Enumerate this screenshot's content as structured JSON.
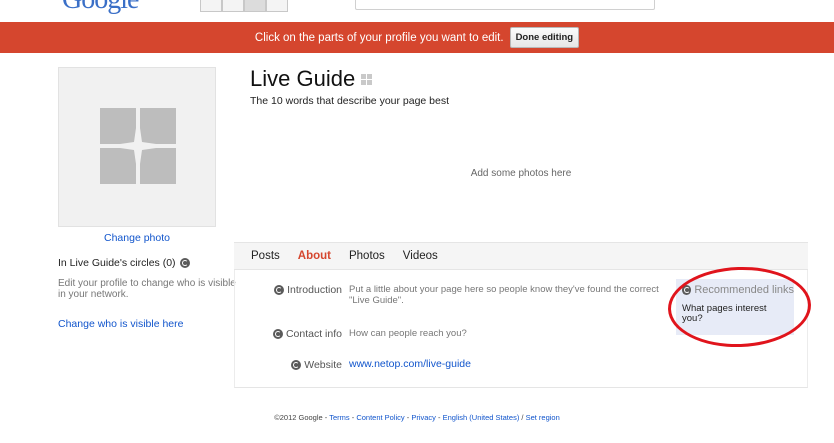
{
  "banner": {
    "message": "Click on the parts of your profile you want to edit.",
    "done_label": "Done editing"
  },
  "sidebar": {
    "change_photo": "Change photo",
    "circles": "In Live Guide's circles (0)",
    "edit_note": "Edit your profile to change who is visible in your network.",
    "change_visible": "Change who is visible here"
  },
  "profile": {
    "name": "Live Guide",
    "tagline": "The 10 words that describe your page best",
    "add_photos": "Add some photos here"
  },
  "tabs": [
    {
      "label": "Posts",
      "active": false
    },
    {
      "label": "About",
      "active": true
    },
    {
      "label": "Photos",
      "active": false
    },
    {
      "label": "Videos",
      "active": false
    }
  ],
  "about": {
    "introduction_label": "Introduction",
    "introduction_value": "Put a little about your page here so people know they've found the correct \"Live Guide\".",
    "contact_label": "Contact info",
    "contact_value": "How can people reach you?",
    "website_label": "Website",
    "website_value": "www.netop.com/live-guide",
    "recommended_title": "Recommended links",
    "recommended_question": "What pages interest you?"
  },
  "footer": {
    "copyright": "©2012 Google - ",
    "terms": "Terms",
    "sep1": " - ",
    "content_policy": "Content Policy",
    "sep2": " - ",
    "privacy": "Privacy",
    "sep3": " - ",
    "language": "English (United States)",
    "sep4": " / ",
    "set_region": "Set region"
  },
  "colors": {
    "banner": "#d5462e",
    "link": "#1155cc",
    "active_tab": "#d5462e",
    "annotation_oval": "#e0141c"
  }
}
